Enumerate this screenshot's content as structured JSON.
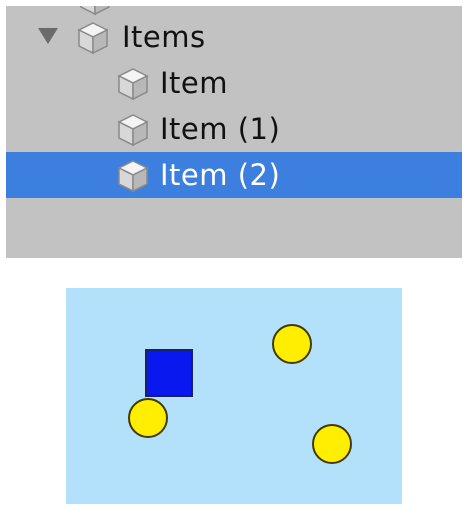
{
  "hierarchy": {
    "parent": {
      "label": "Items",
      "expanded": true,
      "icon": "gameobject-cube-icon"
    },
    "children": [
      {
        "label": "Item",
        "icon": "gameobject-cube-icon",
        "selected": false
      },
      {
        "label": "Item (1)",
        "icon": "gameobject-cube-icon",
        "selected": false
      },
      {
        "label": "Item (2)",
        "icon": "gameobject-cube-icon",
        "selected": true
      }
    ],
    "colors": {
      "panel": "#c2c2c2",
      "selection": "#3d7fdf"
    }
  },
  "scene": {
    "background": "#b3e0fb",
    "player_color": "#0a18f0",
    "coin_color": "#ffee00"
  }
}
